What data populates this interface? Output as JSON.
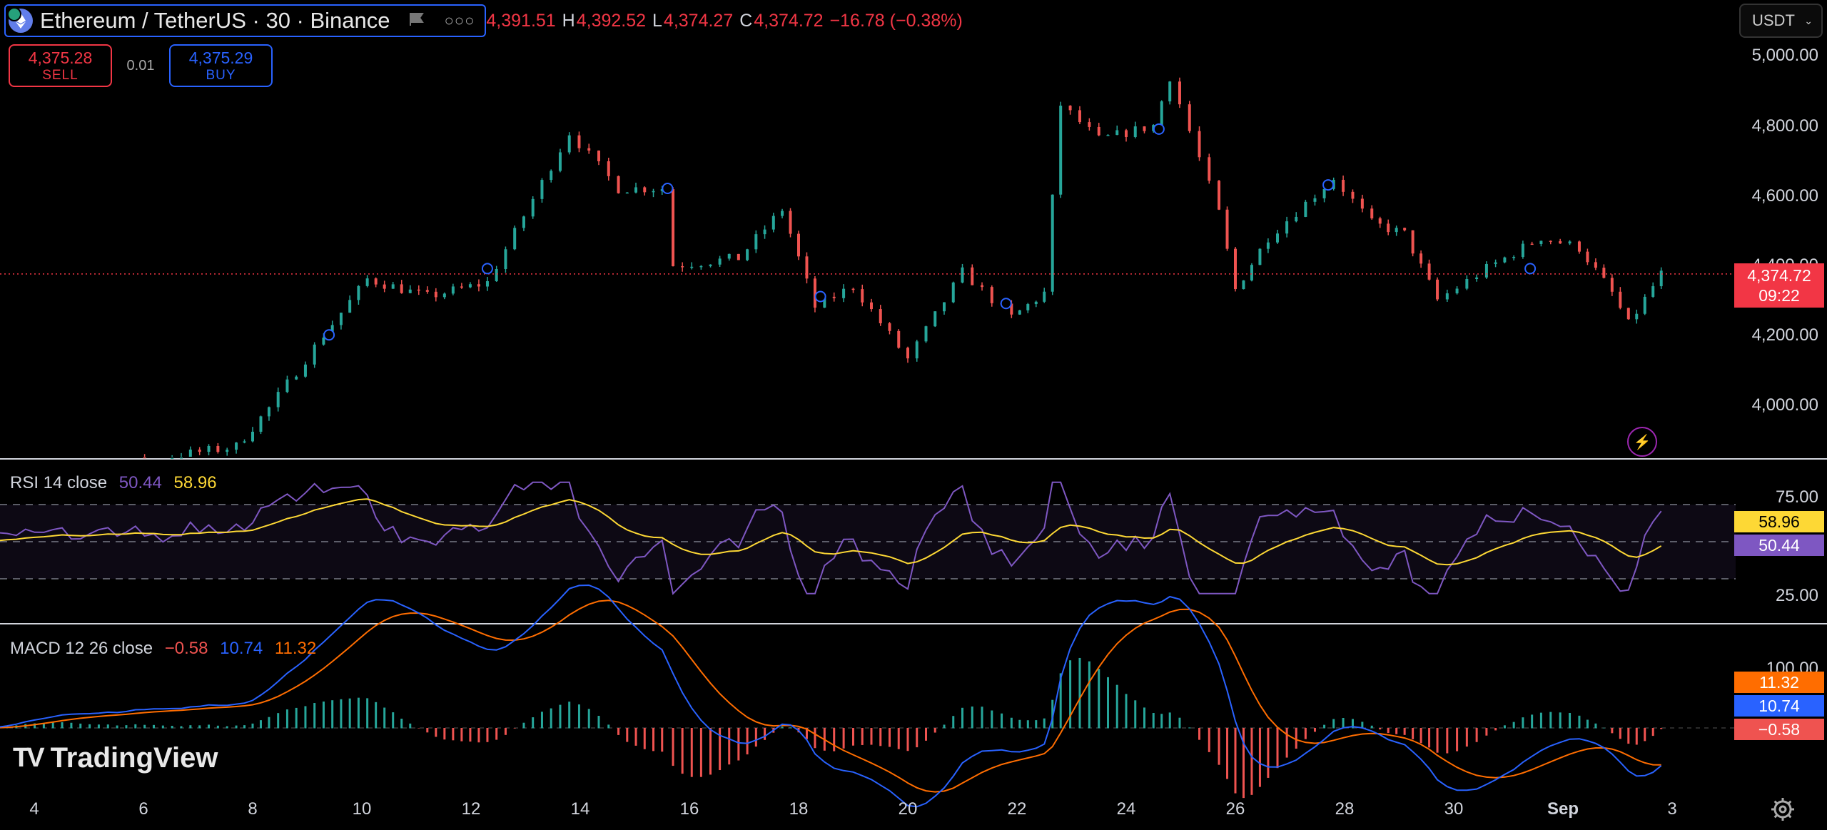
{
  "header": {
    "symbol_title": "Ethereum / TetherUS · 30 · Binance",
    "more_icon": "ellipsis-icon",
    "flag_icon": "flag-icon",
    "ohlc": {
      "open": "4,391.51",
      "high_key": "H",
      "high": "4,392.52",
      "low_key": "L",
      "low": "4,374.27",
      "close_key": "C",
      "close": "4,374.72",
      "change": "−16.78 (−0.38%)"
    }
  },
  "trade": {
    "sell_price": "4,375.28",
    "sell_label": "SELL",
    "spread": "0.01",
    "buy_price": "4,375.29",
    "buy_label": "BUY"
  },
  "currency_select": {
    "value": "USDT"
  },
  "price_axis": {
    "ticks": [
      "5,000.00",
      "4,800.00",
      "4,600.00",
      "4,400.00",
      "4,200.00",
      "4,000.00"
    ],
    "last_price": "4,374.72",
    "countdown": "09:22"
  },
  "rsi": {
    "label": "RSI 14 close",
    "value": "50.44",
    "ma_value": "58.96",
    "ticks": [
      "75.00",
      "25.00"
    ]
  },
  "macd": {
    "label": "MACD 12 26 close",
    "hist": "−0.58",
    "macd": "10.74",
    "signal": "11.32",
    "tick": "100.00"
  },
  "x_axis": [
    "4",
    "6",
    "8",
    "10",
    "12",
    "14",
    "16",
    "18",
    "20",
    "22",
    "24",
    "26",
    "28",
    "30",
    "Sep",
    "3"
  ],
  "branding": {
    "logo_text": "TradingView"
  },
  "colors": {
    "up": "#26a69a",
    "down": "#ef5350",
    "rsi": "#7e57c2",
    "rsi_ma": "#fdd835",
    "macd": "#2962ff",
    "signal": "#ff6d00",
    "accent": "#2962ff",
    "last_price": "#f23645"
  },
  "chart_data": {
    "type": "line",
    "title": "Ethereum / TetherUS · 30 · Binance",
    "x": [
      "4",
      "6",
      "8",
      "10",
      "12",
      "14",
      "16",
      "18",
      "20",
      "22",
      "24",
      "26",
      "28",
      "30",
      "Sep",
      "3"
    ],
    "ylim": [
      3880,
      5070
    ],
    "series": [
      {
        "values": [
          3770,
          3850,
          3920,
          4150,
          4310,
          4390,
          4760,
          4600,
          4390,
          4280,
          4080,
          4320,
          4260,
          4850,
          4770,
          4350,
          4550,
          4480,
          4310,
          4300,
          4440,
          4320,
          4374.72
        ]
      }
    ],
    "approx_key_points": [
      [
        3.0,
        3770
      ],
      [
        7.7,
        3880
      ],
      [
        8.3,
        3990
      ],
      [
        9.3,
        4200
      ],
      [
        10.1,
        4360
      ],
      [
        11.2,
        4310
      ],
      [
        12.3,
        4350
      ],
      [
        13.8,
        4780
      ],
      [
        14.7,
        4620
      ],
      [
        15.5,
        4620
      ],
      [
        15.7,
        4400
      ],
      [
        16.9,
        4420
      ],
      [
        17.7,
        4560
      ],
      [
        18.3,
        4280
      ],
      [
        19.0,
        4340
      ],
      [
        20.0,
        4130
      ],
      [
        21.0,
        4380
      ],
      [
        21.9,
        4250
      ],
      [
        22.5,
        4320
      ],
      [
        22.8,
        4860
      ],
      [
        23.5,
        4760
      ],
      [
        24.5,
        4800
      ],
      [
        24.8,
        4940
      ],
      [
        25.7,
        4550
      ],
      [
        26.0,
        4330
      ],
      [
        26.6,
        4480
      ],
      [
        27.8,
        4650
      ],
      [
        28.5,
        4520
      ],
      [
        29.1,
        4490
      ],
      [
        29.7,
        4300
      ],
      [
        30.6,
        4390
      ],
      [
        31.6,
        4480
      ],
      [
        32.3,
        4450
      ],
      [
        32.9,
        4320
      ],
      [
        33.2,
        4230
      ],
      [
        33.8,
        4374.72
      ]
    ],
    "rsi": {
      "range": [
        0,
        100
      ],
      "bands": [
        30,
        50,
        70
      ],
      "last": 50.44,
      "ma_last": 58.96
    },
    "macd": {
      "zero": 0,
      "last_hist": -0.58,
      "last_macd": 10.74,
      "last_signal": 11.32
    }
  }
}
